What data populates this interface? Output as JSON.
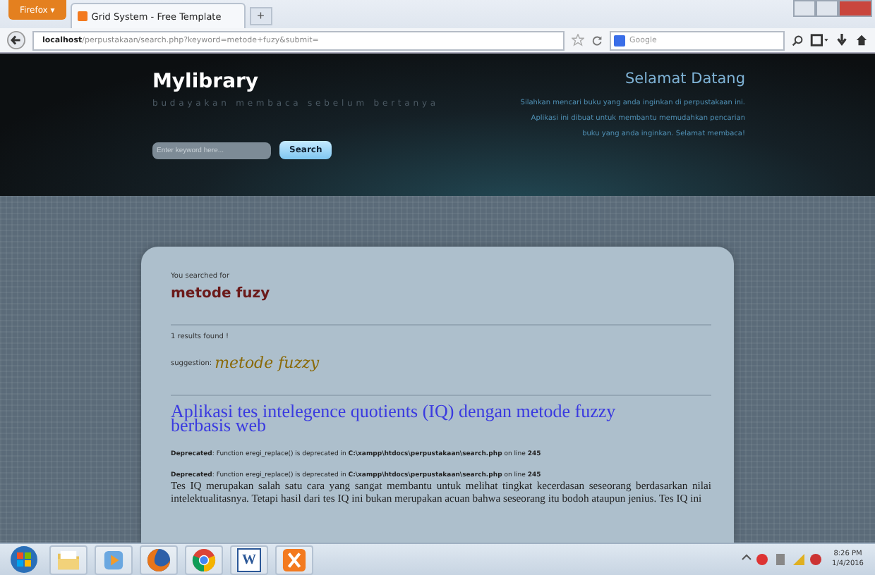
{
  "browser": {
    "menu_button": "Firefox ▾",
    "tabs": [
      {
        "title": "Grid System - Free Template",
        "selected": true
      }
    ],
    "new_tab": "+",
    "url_host": "localhost",
    "url_path": "/perpustakaan/search.php?keyword=metode+fuzy&submit=",
    "search_placeholder": "Google"
  },
  "header": {
    "site_title": "Mylibrary",
    "tagline": "budayakan membaca sebelum bertanya",
    "search_placeholder": "Enter keyword here...",
    "search_button": "Search",
    "welcome_title": "Selamat Datang",
    "welcome_text": "Silahkan mencari buku yang anda inginkan di perpustakaan ini. Aplikasi ini dibuat untuk membantu memudahkan pencarian buku yang anda inginkan. Selamat membaca!"
  },
  "results": {
    "searched_label": "You searched for",
    "query": "metode fuzy",
    "count": "1 results found !",
    "suggestion_label": "suggestion:",
    "suggestion": "metode fuzzy",
    "items": [
      {
        "title": "Aplikasi tes intelegence quotients (IQ) dengan metode fuzzy berbasis web",
        "warnings": [
          "**Deprecated**: Function eregi_replace() is deprecated in **C:\\xampp\\htdocs\\perpustakaan\\search.php** on line **245**",
          "**Deprecated**: Function eregi_replace() is deprecated in **C:\\xampp\\htdocs\\perpustakaan\\search.php** on line **245**"
        ],
        "snippet": "Tes IQ merupakan salah satu cara yang sangat membantu untuk melihat tingkat kecerdasan seseorang berdasarkan nilai intelektualitasnya. Tetapi hasil dari tes IQ ini bukan merupakan acuan bahwa seseorang itu bodoh ataupun jenius. Tes IQ ini"
      }
    ]
  },
  "taskbar": {
    "apps": [
      {
        "kind": "start"
      },
      {
        "kind": "folder"
      },
      {
        "kind": "media"
      },
      {
        "kind": "firefox"
      },
      {
        "kind": "chrome"
      },
      {
        "kind": "word",
        "label": "W"
      },
      {
        "kind": "xampp"
      }
    ],
    "time": "8:26 PM",
    "date": "1/4/2016"
  }
}
